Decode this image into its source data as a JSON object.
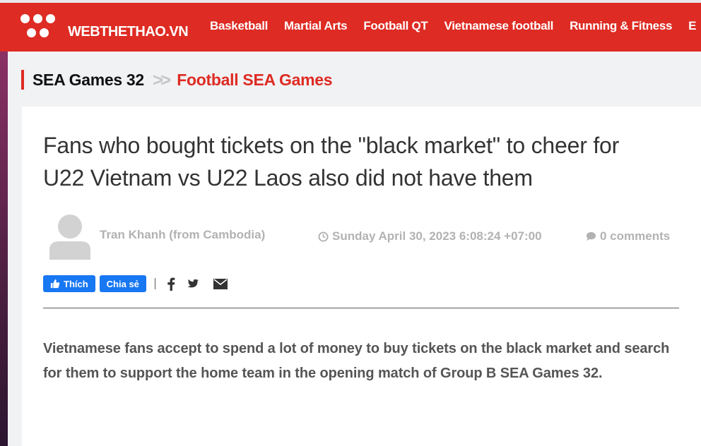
{
  "header": {
    "brand": "WEBTHETHAO.VN",
    "nav": [
      "Basketball",
      "Martial Arts",
      "Football QT",
      "Vietnamese football",
      "Running & Fitness",
      "E"
    ]
  },
  "breadcrumb": {
    "parent": "SEA Games 32",
    "separator": ">>",
    "current": "Football SEA Games"
  },
  "article": {
    "title": "Fans who bought tickets on the \"black market\" to cheer for U22 Vietnam vs U22 Laos also did not have them",
    "author": "Tran Khanh (from Cambodia)",
    "date": "Sunday April 30, 2023 6:08:24 +07:00",
    "comments": "0 comments",
    "lead": "Vietnamese fans accept to spend a lot of money to buy tickets on the black market and search for them to support the home team in the opening match of Group B SEA Games 32."
  },
  "share": {
    "like_label": "Thích",
    "share_label": "Chia sẻ",
    "icons": [
      "facebook-icon",
      "twitter-icon",
      "email-icon"
    ]
  },
  "colors": {
    "brand_red": "#de2b23",
    "facebook_blue": "#1877f2",
    "meta_gray": "#b2b2b2"
  }
}
